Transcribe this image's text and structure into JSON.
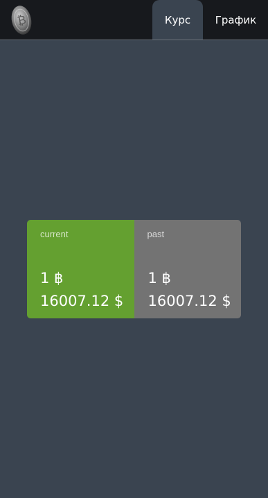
{
  "header": {
    "logo_icon": "bitcoin-coin-icon",
    "tabs": [
      {
        "label": "Курс",
        "active": true
      },
      {
        "label": "График",
        "active": false
      }
    ]
  },
  "rates": {
    "current": {
      "label": "current",
      "amount": "1 ฿",
      "price": "16007.12 $"
    },
    "past": {
      "label": "past",
      "amount": "1 ฿",
      "price": "16007.12 $"
    }
  },
  "colors": {
    "header_bg": "#17191d",
    "page_bg": "#3a4450",
    "current_bg": "#64a030",
    "past_bg": "#737373"
  }
}
